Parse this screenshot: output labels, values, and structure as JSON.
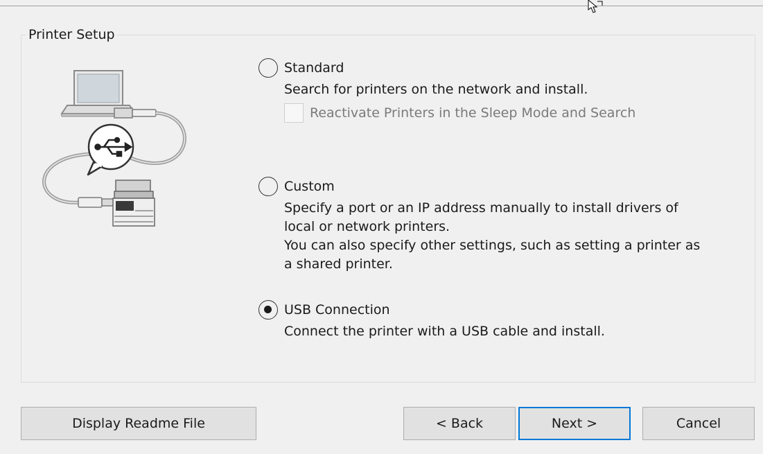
{
  "group_title": "Printer Setup",
  "options": {
    "standard": {
      "label": "Standard",
      "selected": false,
      "description": [
        "Search for printers on the network and install."
      ],
      "checkbox": {
        "label": "Reactivate Printers in the Sleep Mode and Search",
        "checked": false,
        "enabled": false
      }
    },
    "custom": {
      "label": "Custom",
      "selected": false,
      "description": [
        "Specify a port or an IP address manually to install drivers of",
        "local or network printers.",
        "You can also specify other settings, such as setting a printer as",
        "a shared printer."
      ]
    },
    "usb": {
      "label": "USB Connection",
      "selected": true,
      "description": [
        "Connect the printer with a USB cable and install."
      ]
    }
  },
  "buttons": {
    "readme": "Display Readme File",
    "back": "< Back",
    "next": "Next >",
    "cancel": "Cancel"
  },
  "icons": {
    "illustration": "laptop-usb-printer-illustration",
    "usb": "usb-icon",
    "cursor": "mouse-cursor-icon"
  },
  "colors": {
    "default_button_border": "#0078d7",
    "background": "#f0f0f0"
  }
}
